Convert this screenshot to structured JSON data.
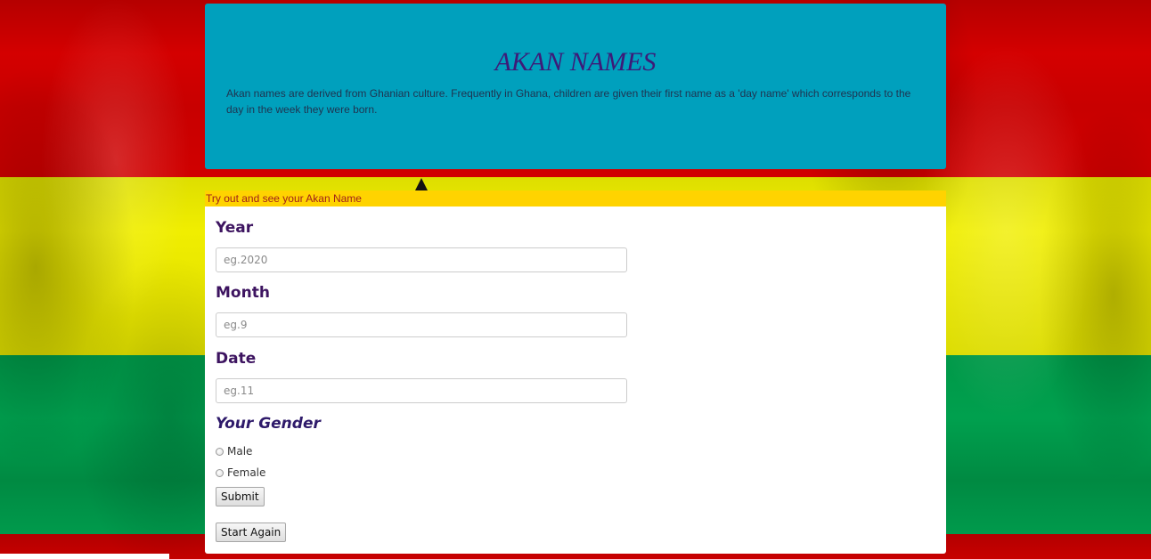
{
  "header": {
    "title": "AKAN NAMES",
    "intro": "Akan names are derived from Ghanian culture. Frequently in Ghana, children are given their first name as a 'day name' which corresponds to the day in the week they were born."
  },
  "form": {
    "banner": "Try out and see your Akan Name",
    "year": {
      "label": "Year",
      "placeholder": "eg.2020"
    },
    "month": {
      "label": "Month",
      "placeholder": "eg.9"
    },
    "date": {
      "label": "Date",
      "placeholder": "eg.11"
    },
    "gender": {
      "label": "Your Gender",
      "options": [
        "Male",
        "Female"
      ]
    },
    "submit_label": "Submit",
    "reset_label": "Start Again"
  },
  "colors": {
    "header_bg": "#00a0bd",
    "banner_bg": "#ffd300",
    "flag_red": "#d00000",
    "flag_yellow": "#f0ee00",
    "flag_green": "#00a04e",
    "label_purple": "#3d1460"
  }
}
